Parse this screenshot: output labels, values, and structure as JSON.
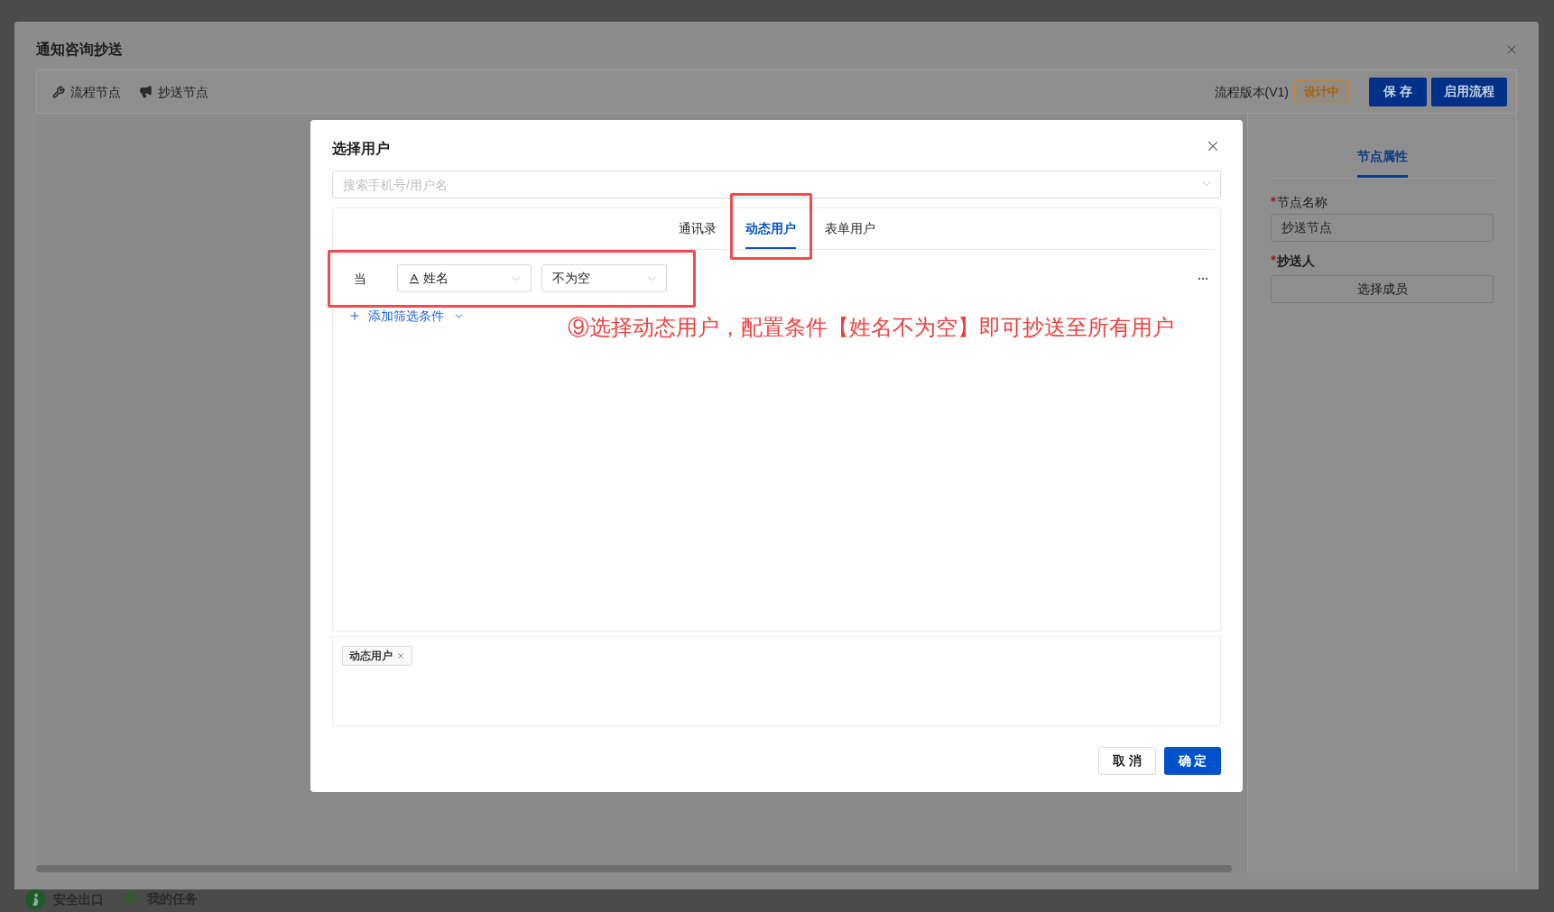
{
  "drawer": {
    "title": "通知咨询抄送",
    "toolbar": {
      "nodes": [
        {
          "label": "流程节点",
          "kind": "wrench"
        },
        {
          "label": "抄送节点",
          "kind": "megaphone"
        }
      ],
      "version": "流程版本(V1)",
      "status_badge": "设计中",
      "buttons": [
        {
          "label": "保 存"
        },
        {
          "label": "启用流程"
        }
      ]
    },
    "properties_panel": {
      "tabs": [
        {
          "label": "节点属性",
          "selected": true
        }
      ],
      "fields": [
        {
          "label": "节点名称",
          "required": true,
          "kind": "input",
          "value": "抄送节点"
        },
        {
          "label": "抄送人",
          "required": true,
          "kind": "button",
          "value": "选择成员"
        }
      ]
    }
  },
  "dialog": {
    "title": "选择用户",
    "search": {
      "placeholder": "搜索手机号/用户名"
    },
    "tabs": [
      {
        "label": "通讯录",
        "selected": false
      },
      {
        "label": "动态用户",
        "selected": true
      },
      {
        "label": "表单用户",
        "selected": false
      }
    ],
    "condition": {
      "prefix": "当",
      "field": "姓名",
      "operator": "不为空"
    },
    "add_filter": "添加筛选条件",
    "selected_tags": [
      {
        "label": "动态用户"
      }
    ],
    "buttons": [
      {
        "label": "取 消",
        "kind": "default"
      },
      {
        "label": "确 定",
        "kind": "primary"
      }
    ]
  },
  "annotation": {
    "text": "⑨选择动态用户，配置条件【姓名不为空】即可抄送至所有用户"
  },
  "background_app": {
    "bottom_bar": [
      {
        "label": "安全出口",
        "kind": "exit"
      },
      {
        "label": "我的任务",
        "kind": "tasks"
      }
    ]
  }
}
